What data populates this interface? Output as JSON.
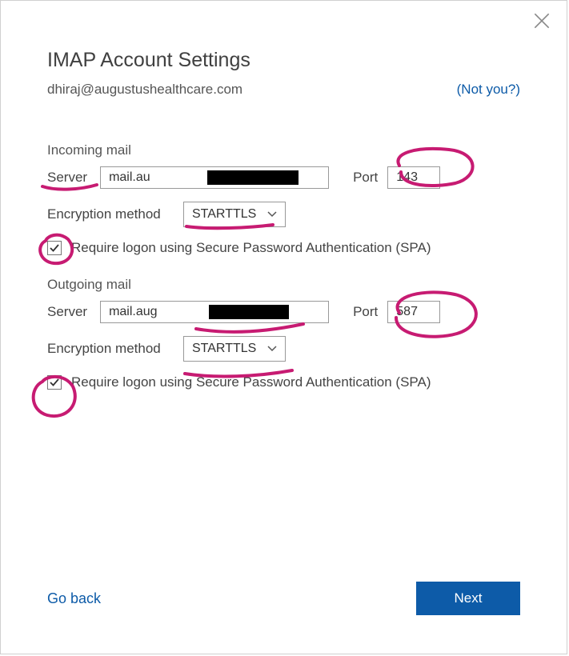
{
  "title": "IMAP Account Settings",
  "email": "dhiraj@augustushealthcare.com",
  "not_you": "(Not you?)",
  "incoming": {
    "section_label": "Incoming mail",
    "server_label": "Server",
    "server_value": "mail.au                       are.com",
    "port_label": "Port",
    "port_value": "143",
    "encryption_label": "Encryption method",
    "encryption_value": "STARTTLS",
    "spa_label": "Require logon using Secure Password Authentication (SPA)",
    "spa_checked": true
  },
  "outgoing": {
    "section_label": "Outgoing mail",
    "server_label": "Server",
    "server_value": "mail.aug                     are.com",
    "port_label": "Port",
    "port_value": "587",
    "encryption_label": "Encryption method",
    "encryption_value": "STARTTLS",
    "spa_label": "Require logon using Secure Password Authentication (SPA)",
    "spa_checked": true
  },
  "footer": {
    "go_back": "Go back",
    "next": "Next"
  },
  "annotation_color": "#c71b72"
}
